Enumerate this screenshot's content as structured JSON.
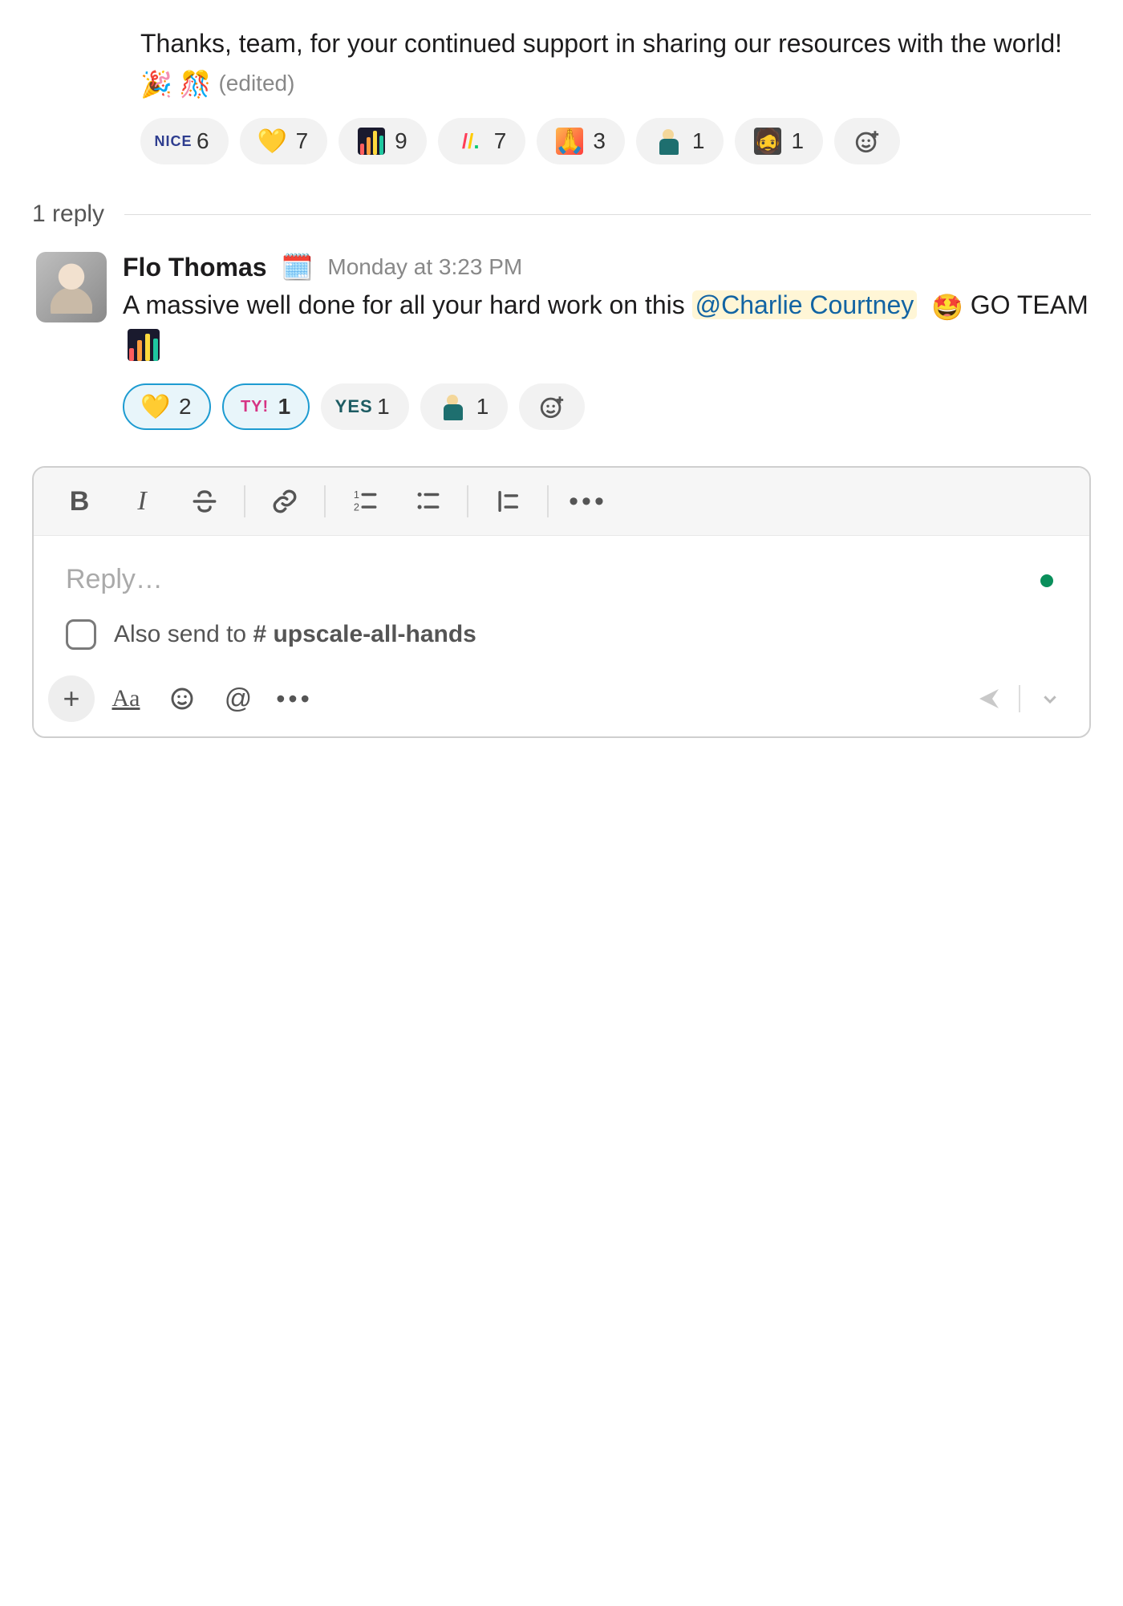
{
  "parent_message": {
    "text": "Thanks, team, for your continued support in sharing our resources with the world!",
    "trailing_emojis": [
      "🎉",
      "🎊"
    ],
    "edited_label": "(edited)",
    "reactions": [
      {
        "icon": "nice",
        "label": "NICE",
        "count": 6
      },
      {
        "icon": "heart",
        "label": "💛",
        "count": 7
      },
      {
        "icon": "bars",
        "label": "bars-logo",
        "count": 9
      },
      {
        "icon": "slashes",
        "label": "monday-slashes",
        "count": 7
      },
      {
        "icon": "pray",
        "label": "praying-hands",
        "count": 3
      },
      {
        "icon": "burns",
        "label": "mr-burns-excellent",
        "count": 1
      },
      {
        "icon": "face",
        "label": "face-photo",
        "count": 1
      }
    ]
  },
  "thread": {
    "reply_count_label": "1 reply"
  },
  "reply": {
    "author": "Flo Thomas",
    "status_emoji": "🗓️",
    "timestamp": "Monday at 3:23 PM",
    "text_pre": "A massive well done for all your hard work on this ",
    "mention": "@Charlie Courtney",
    "text_mid_emoji": "🤩",
    "text_post": "GO TEAM",
    "trailing_icon": "bars",
    "reactions": [
      {
        "icon": "heart",
        "label": "💛",
        "count": 2,
        "selected": true
      },
      {
        "icon": "ty",
        "label": "TY!",
        "count": 1,
        "selected": true
      },
      {
        "icon": "yes",
        "label": "YES",
        "count": 1,
        "selected": false
      },
      {
        "icon": "burns",
        "label": "mr-burns-excellent",
        "count": 1,
        "selected": false
      }
    ]
  },
  "composer": {
    "placeholder": "Reply…",
    "also_send_prefix": "Also send to ",
    "also_send_channel": "# upscale-all-hands"
  }
}
